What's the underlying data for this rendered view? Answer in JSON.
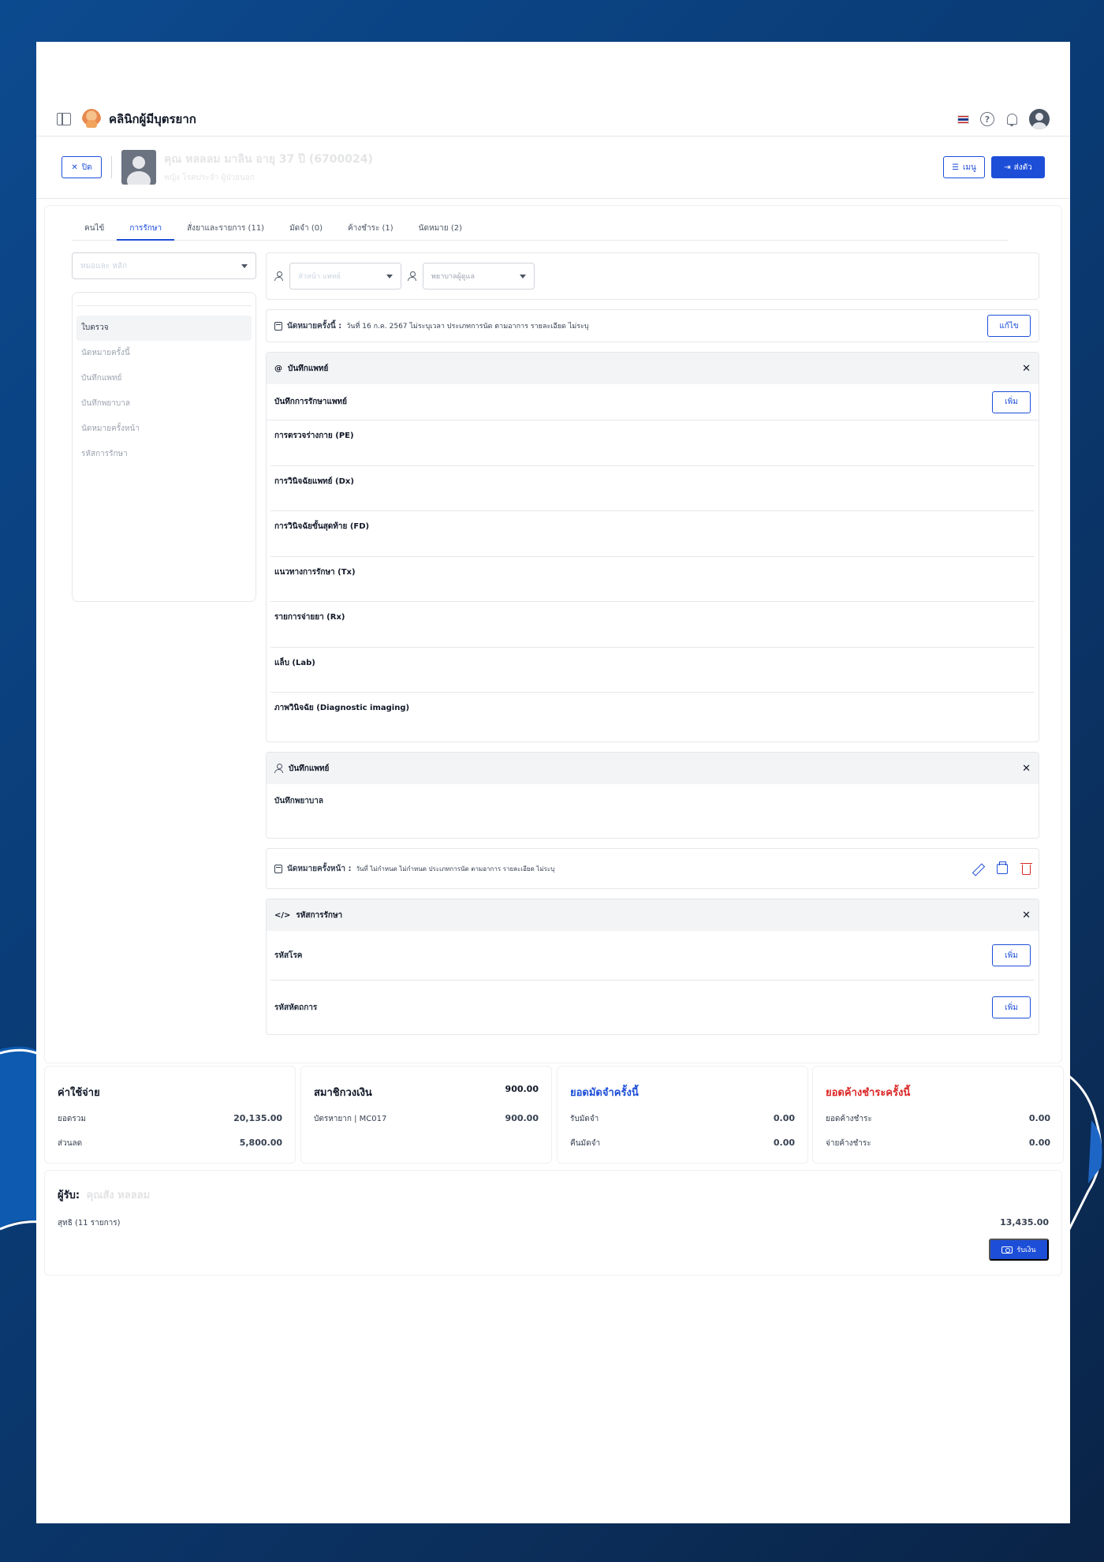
{
  "app": {
    "title": "คลินิกผู้มีบุตรยาก"
  },
  "patient_bar": {
    "close_label": "ปิด",
    "patient_name": "คุณ หลลลม มาลิน",
    "patient_age": "อายุ 37 ปี (6700024)",
    "patient_sub": "หญิง   โรคประจำ   ผู้ป่วยนอก",
    "menu_label": "เมนู",
    "send_label": "ส่งตัว"
  },
  "tabs": [
    "คนไข้",
    "การรักษา",
    "สั่งยาและรายการ (11)",
    "มัดจำ (0)",
    "ค้างชำระ (1)",
    "นัดหมาย (2)"
  ],
  "left": {
    "select_placeholder": "หมอและ หลัก",
    "items": [
      "ใบตรวจ",
      "นัดหมายครั้งนี้",
      "บันทึกแพทย์",
      "บันทึกพยาบาล",
      "นัดหมายครั้งหน้า",
      "รหัสการรักษา"
    ]
  },
  "filters": {
    "doctor_placeholder": "หัวหน้า แพทย์",
    "nurse_placeholder": "พยาบาลผู้ดูแล"
  },
  "current_appt": {
    "label": "นัดหมายครั้งนี้ :",
    "detail": "วันที่ 16 ก.ค. 2567 ไม่ระบุเวลา   ประเภทการนัด ตามอาการ   รายละเอียด ไม่ระบุ",
    "edit_label": "แก้ไข"
  },
  "doctor_section": {
    "title": "บันทึกแพทย์",
    "subtitle": "บันทึกการรักษาแพทย์",
    "add_label": "เพิ่ม",
    "fields": [
      "การตรวจร่างกาย (PE)",
      "การวินิจฉัยแพทย์ (Dx)",
      "การวินิจฉัยขั้นสุดท้าย (FD)",
      "แนวทางการรักษา (Tx)",
      "รายการจ่ายยา (Rx)",
      "แล็บ (Lab)",
      "ภาพวินิจฉัย (Diagnostic imaging)"
    ]
  },
  "nurse_section": {
    "title": "บันทึกแพทย์",
    "body": "บันทึกพยาบาล"
  },
  "next_appt": {
    "label": "นัดหมายครั้งหน้า :",
    "detail": "วันที่ ไม่กำหนด ไม่กำหนด   ประเภทการนัด ตามอาการ   รายละเอียด ไม่ระบุ"
  },
  "code_section": {
    "title": "รหัสการรักษา",
    "rows": [
      {
        "label": "รหัสโรค",
        "button": "เพิ่ม"
      },
      {
        "label": "รหัสหัตถการ",
        "button": "เพิ่ม"
      }
    ]
  },
  "expenses": {
    "title": "ค่าใช้จ่าย",
    "rows": [
      {
        "label": "ยอดรวม",
        "value": "20,135.00"
      },
      {
        "label": "ส่วนลด",
        "value": "5,800.00"
      }
    ]
  },
  "membership": {
    "title": "สมาชิกวงเงิน",
    "total": "900.00",
    "rows": [
      {
        "label": "บัตรหายาก | MC017",
        "value": "900.00"
      }
    ]
  },
  "deposit": {
    "title": "ยอดมัดจำครั้งนี้",
    "rows": [
      {
        "label": "รับมัดจำ",
        "value": "0.00"
      },
      {
        "label": "คืนมัดจำ",
        "value": "0.00"
      }
    ]
  },
  "outstanding": {
    "title": "ยอดค้างชำระครั้งนี้",
    "rows": [
      {
        "label": "ยอดค้างชำระ",
        "value": "0.00"
      },
      {
        "label": "จ่ายค้างชำระ",
        "value": "0.00"
      }
    ]
  },
  "receiver": {
    "label": "ผู้รับ:",
    "name": "คุณสัง หลลลม",
    "net_label": "สุทธิ (11 รายการ)",
    "net_value": "13,435.00",
    "receive_label": "รับเงิน"
  },
  "colors": {
    "primary": "#1d4ed8",
    "danger": "#dc2626",
    "background": "#0c4a8f"
  }
}
